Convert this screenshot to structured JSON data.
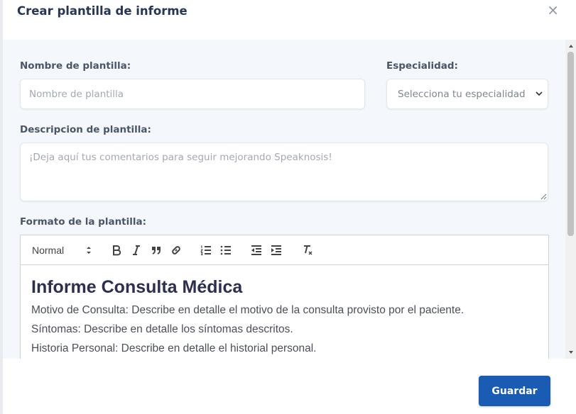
{
  "modal": {
    "title": "Crear plantilla de informe",
    "close_label": "×"
  },
  "form": {
    "name_label": "Nombre de plantilla:",
    "name_placeholder": "Nombre de plantilla",
    "specialty_label": "Especialidad:",
    "specialty_selected": "Selecciona tu especialidad",
    "description_label": "Descripcion de plantilla:",
    "description_placeholder": "¡Deja aquí tus comentarios para seguir mejorando Speaknosis!",
    "format_label": "Formato de la plantilla:"
  },
  "editor": {
    "toolbar": {
      "format_value": "Normal",
      "buttons": [
        "bold-icon",
        "italic-icon",
        "blockquote-icon",
        "link-icon",
        "ordered-list-icon",
        "bullet-list-icon",
        "outdent-icon",
        "indent-icon",
        "clear-format-icon"
      ]
    },
    "heading": "Informe Consulta Médica",
    "lines": [
      "Motivo de Consulta: Describe en detalle el motivo de la consulta provisto por el paciente.",
      "Síntomas: Describe en detalle los síntomas descritos.",
      "Historia Personal: Describe en detalle el historial personal."
    ]
  },
  "footer": {
    "save_label": "Guardar"
  },
  "colors": {
    "primary": "#1a5bb4",
    "title": "#283655",
    "body_bg": "#f4f7fb"
  }
}
